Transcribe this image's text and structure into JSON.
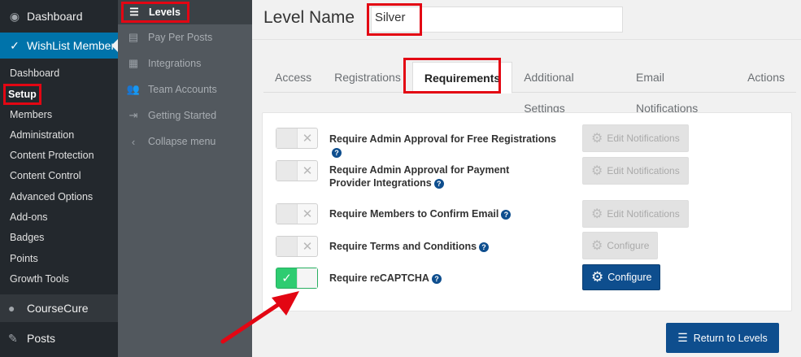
{
  "admin_menu": {
    "dashboard": "Dashboard",
    "wishlist_member": "WishList Member",
    "submenu": [
      "Dashboard",
      "Setup",
      "Members",
      "Administration",
      "Content Protection",
      "Content Control",
      "Advanced Options",
      "Add-ons",
      "Badges",
      "Points",
      "Growth Tools"
    ],
    "coursecure": "CourseCure",
    "posts": "Posts"
  },
  "setup_menu": {
    "items": [
      {
        "label": "Levels",
        "icon": "list-icon",
        "active": true
      },
      {
        "label": "Pay Per Posts",
        "icon": "document-icon"
      },
      {
        "label": "Integrations",
        "icon": "calendar-icon"
      },
      {
        "label": "Team Accounts",
        "icon": "team-icon"
      },
      {
        "label": "Getting Started",
        "icon": "login-icon"
      },
      {
        "label": "Collapse menu",
        "icon": "chevron-left-icon"
      }
    ]
  },
  "level": {
    "title": "Level Name",
    "name_value": "Silver"
  },
  "tabs": [
    "Access",
    "Registrations",
    "Requirements",
    "Additional Settings",
    "Email Notifications",
    "Actions"
  ],
  "active_tab": "Requirements",
  "requirements": [
    {
      "label": "Require Admin Approval for Free Registrations",
      "enabled": false,
      "button": "Edit Notifications",
      "button_enabled": false
    },
    {
      "label": "Require Admin Approval for Payment Provider Integrations",
      "enabled": false,
      "button": "Edit Notifications",
      "button_enabled": false
    },
    {
      "label": "Require Members to Confirm Email",
      "enabled": false,
      "button": "Edit Notifications",
      "button_enabled": false
    },
    {
      "label": "Require Terms and Conditions",
      "enabled": false,
      "button": "Configure",
      "button_enabled": false
    },
    {
      "label": "Require reCAPTCHA",
      "enabled": true,
      "button": "Configure",
      "button_enabled": true
    }
  ],
  "return_button": "Return to Levels",
  "colors": {
    "highlight": "#e30613",
    "primary": "#0e4e8e",
    "toggle_on": "#2ecc71",
    "wp_blue": "#0073aa"
  }
}
